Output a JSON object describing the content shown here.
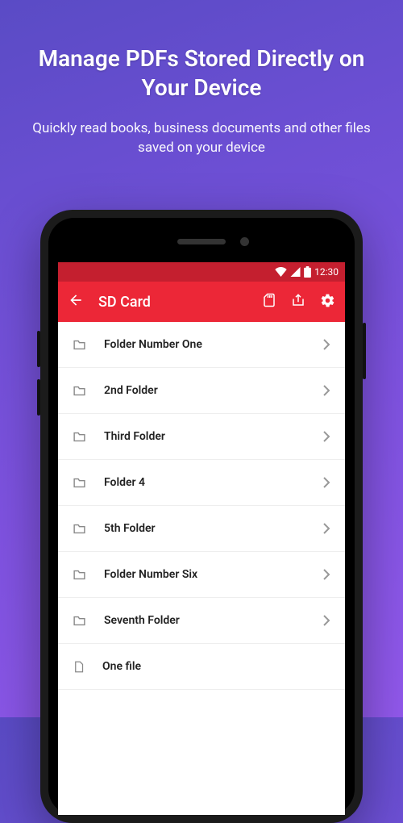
{
  "promo": {
    "title": "Manage PDFs Stored Directly on Your Device",
    "subtitle": "Quickly read books, business documents and other files saved on your device"
  },
  "statusbar": {
    "time": "12:30"
  },
  "appbar": {
    "title": "SD Card"
  },
  "list": {
    "items": [
      {
        "type": "folder",
        "label": "Folder Number One"
      },
      {
        "type": "folder",
        "label": "2nd Folder"
      },
      {
        "type": "folder",
        "label": "Third Folder"
      },
      {
        "type": "folder",
        "label": "Folder 4"
      },
      {
        "type": "folder",
        "label": "5th Folder"
      },
      {
        "type": "folder",
        "label": "Folder Number Six"
      },
      {
        "type": "folder",
        "label": "Seventh Folder"
      },
      {
        "type": "file",
        "label": "One file"
      }
    ]
  }
}
